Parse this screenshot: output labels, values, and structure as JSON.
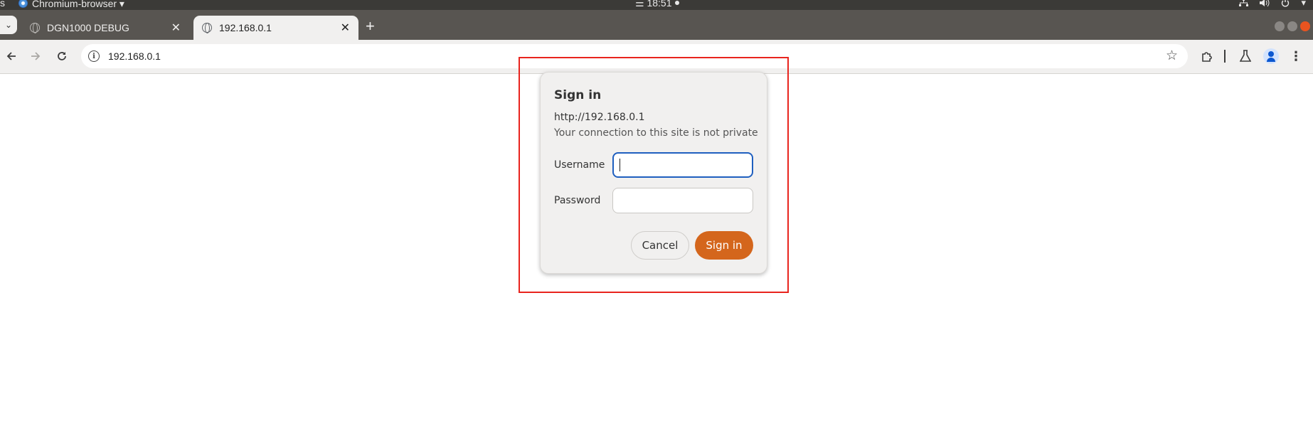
{
  "system_bar": {
    "activities_label": "s",
    "app_name": "Chromium-browser ▾",
    "clock": "☰ 18:51",
    "tray_icons": [
      "network-icon",
      "volume-icon",
      "power-icon"
    ]
  },
  "tabs": [
    {
      "title": "DGN1000 DEBUG",
      "active": false
    },
    {
      "title": "192.168.0.1",
      "active": true
    }
  ],
  "toolbar": {
    "url": "192.168.0.1"
  },
  "dialog": {
    "title": "Sign in",
    "origin": "http://192.168.0.1",
    "warning": "Your connection to this site is not private",
    "username_label": "Username",
    "username_value": "",
    "password_label": "Password",
    "password_value": "",
    "cancel_label": "Cancel",
    "signin_label": "Sign in",
    "accent_color": "#d4661c",
    "focus_color": "#1f5fbf"
  },
  "highlight_color": "#e8241e"
}
